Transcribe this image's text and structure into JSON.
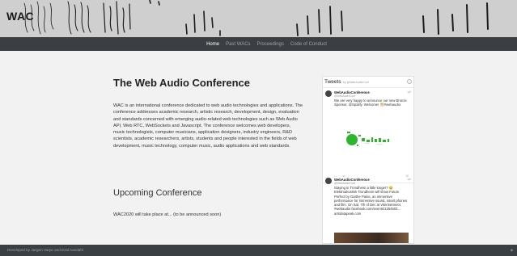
{
  "banner": {
    "logo": "WAC"
  },
  "nav": {
    "items": [
      "Home",
      "Past WACs",
      "Proceedings",
      "Code of Conduct"
    ]
  },
  "main": {
    "title": "The Web Audio Conference",
    "intro": "WAC is an international conference dedicated to web audio technologies and applications. The conference addresses academic research, artistic research, development, design, evaluation and standards concerned with emerging audio-related web technologies such as Web Audio API, Web RTC, WebSockets and Javascript. The conference welcomes web developers, music technologists, computer musicians, application designers, industry engineers, R&D scientists, academic researchers, artists, students and people interested in the fields of web development, music technology, computer music, audio applications and web standards.",
    "upcoming_heading": "Upcoming Conference",
    "upcoming_text": "WAC2020 will take place at... (to be announced soon)"
  },
  "tweets": {
    "title": "Tweets",
    "by": "by @WebAudioConf",
    "items": [
      {
        "name": "WebAudioConference",
        "handle": "@WebAudioConf",
        "text": "We are very happy to announce our new Bronze Sponsor, @Spotify. Welcome! 🎊#webaudio",
        "count": "10"
      },
      {
        "name": "WebAudioConference",
        "handle": "@WebAudioConf",
        "text": "Staying in Trondheim a little longer? 😊 Elektroakustisk Trondheim will show Future Perfect by Garthe Paine, an immersive performance for immersive sound, smart phones and film. On Sat. 7th of Dec at Vitensenteret. #webaudio facebook.com/events/1254503… artsdatapeak.com"
      }
    ]
  },
  "footer": {
    "text": "Developed by Jørgen Varpe and Ezal Aandahl"
  },
  "colors": {
    "nav_bg": "#3a3f44",
    "banner_bg": "#cfcfcf",
    "page_bg": "#f2f2f2",
    "twitter_blue": "#1da1f2",
    "media_green": "#2db52d"
  }
}
